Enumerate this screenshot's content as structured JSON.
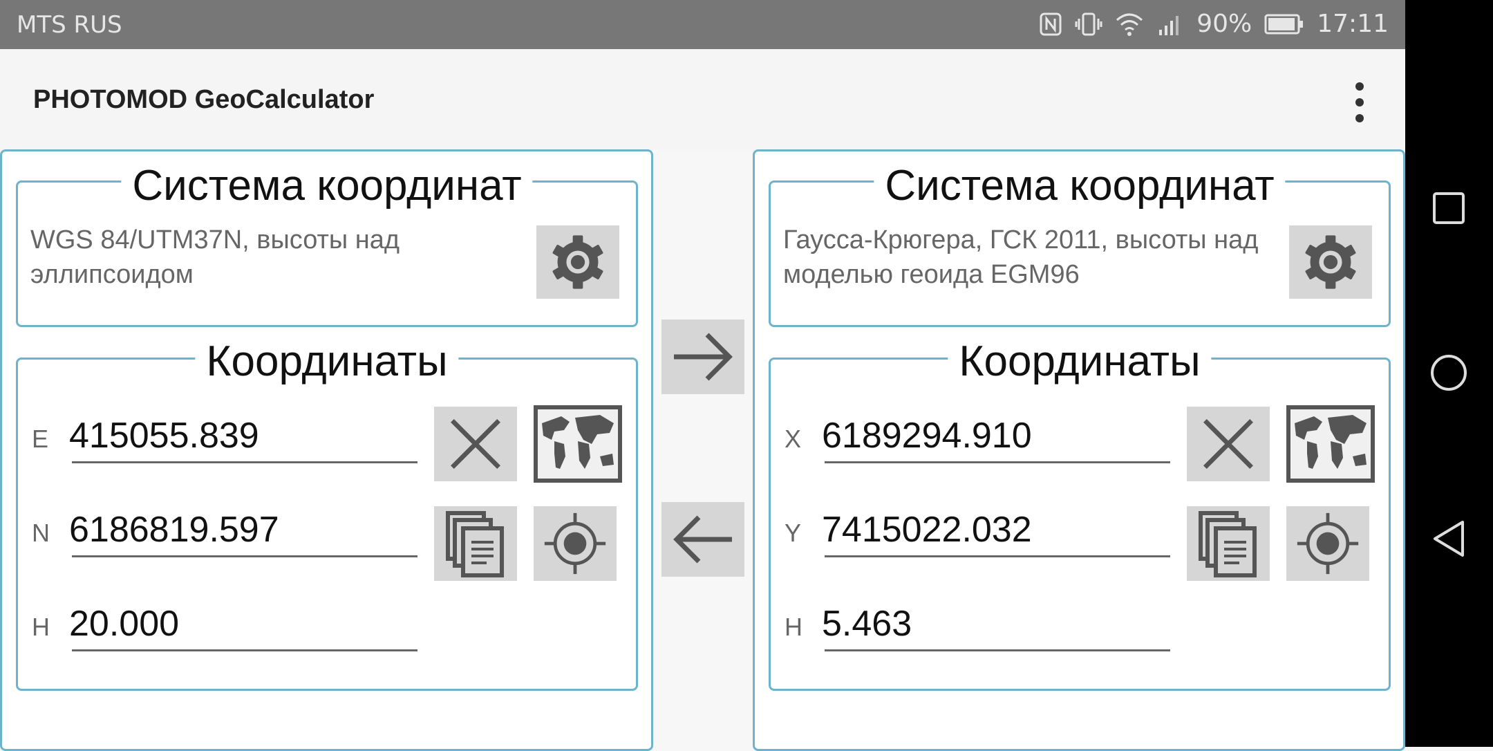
{
  "status_bar": {
    "carrier": "MTS RUS",
    "battery": "90%",
    "time": "17:11"
  },
  "app_bar": {
    "title": "PHOTOMOD GeoCalculator"
  },
  "source": {
    "cs_legend": "Система координат",
    "cs_description": "WGS 84/UTM37N, высоты над эллипсоидом",
    "coords_legend": "Координаты",
    "fields": [
      {
        "label": "E",
        "value": "415055.839"
      },
      {
        "label": "N",
        "value": "6186819.597"
      },
      {
        "label": "H",
        "value": "20.000"
      }
    ]
  },
  "target": {
    "cs_legend": "Система координат",
    "cs_description": "Гаусса-Крюгера, ГСК 2011, высоты над моделью геоида EGM96",
    "coords_legend": "Координаты",
    "fields": [
      {
        "label": "X",
        "value": "6189294.910"
      },
      {
        "label": "Y",
        "value": "7415022.032"
      },
      {
        "label": "H",
        "value": "5.463"
      }
    ]
  },
  "icons": {
    "settings": "gear-icon",
    "clear": "close-icon",
    "map": "world-map-icon",
    "copy": "copy-icon",
    "gps": "gps-target-icon",
    "convert_forward": "arrow-right-icon",
    "convert_back": "arrow-left-icon"
  },
  "colors": {
    "border": "#6db3cc",
    "button_bg": "#d6d6d6",
    "status_bar": "#777777",
    "nav_bar": "#000000"
  }
}
